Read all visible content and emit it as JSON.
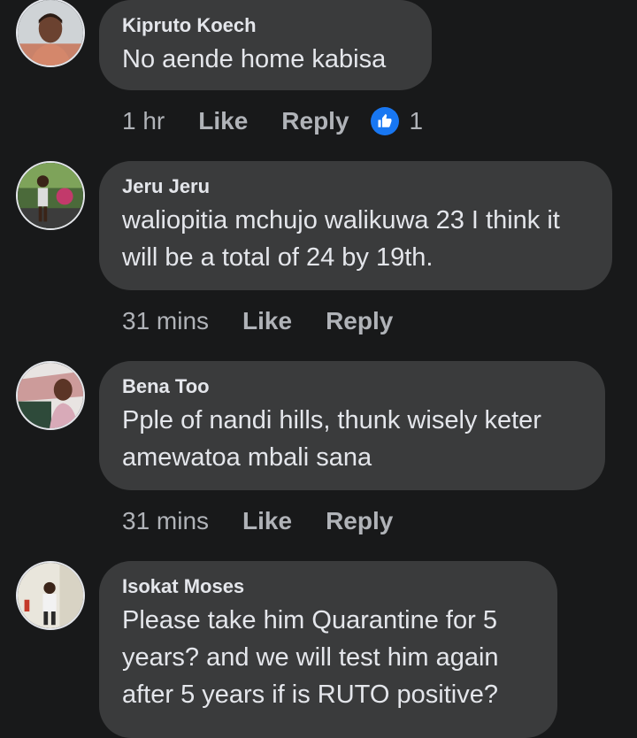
{
  "comments": [
    {
      "author": "Kipruto Koech",
      "text": "No aende home kabisa",
      "time": "1 hr",
      "like_label": "Like",
      "reply_label": "Reply",
      "reactions": {
        "icon": "thumbs-up-icon",
        "count": "1",
        "color": "#1877f2"
      }
    },
    {
      "author": "Jeru Jeru",
      "text": "waliopitia mchujo walikuwa 23 I think it will be a total of 24 by 19th.",
      "time": "31 mins",
      "like_label": "Like",
      "reply_label": "Reply"
    },
    {
      "author": "Bena Too",
      "text": "Pple of nandi hills, thunk wisely keter amewatoa mbali sana",
      "time": "31 mins",
      "like_label": "Like",
      "reply_label": "Reply"
    },
    {
      "author": "Isokat Moses",
      "text": "Please take him Quarantine for 5 years? and we will test him again after 5 years if is RUTO positive?"
    }
  ],
  "colors": {
    "background": "#18191a",
    "bubble": "#3a3b3c",
    "primary_text": "#e4e6eb",
    "secondary_text": "#b0b3b8",
    "like_blue": "#1877f2"
  }
}
